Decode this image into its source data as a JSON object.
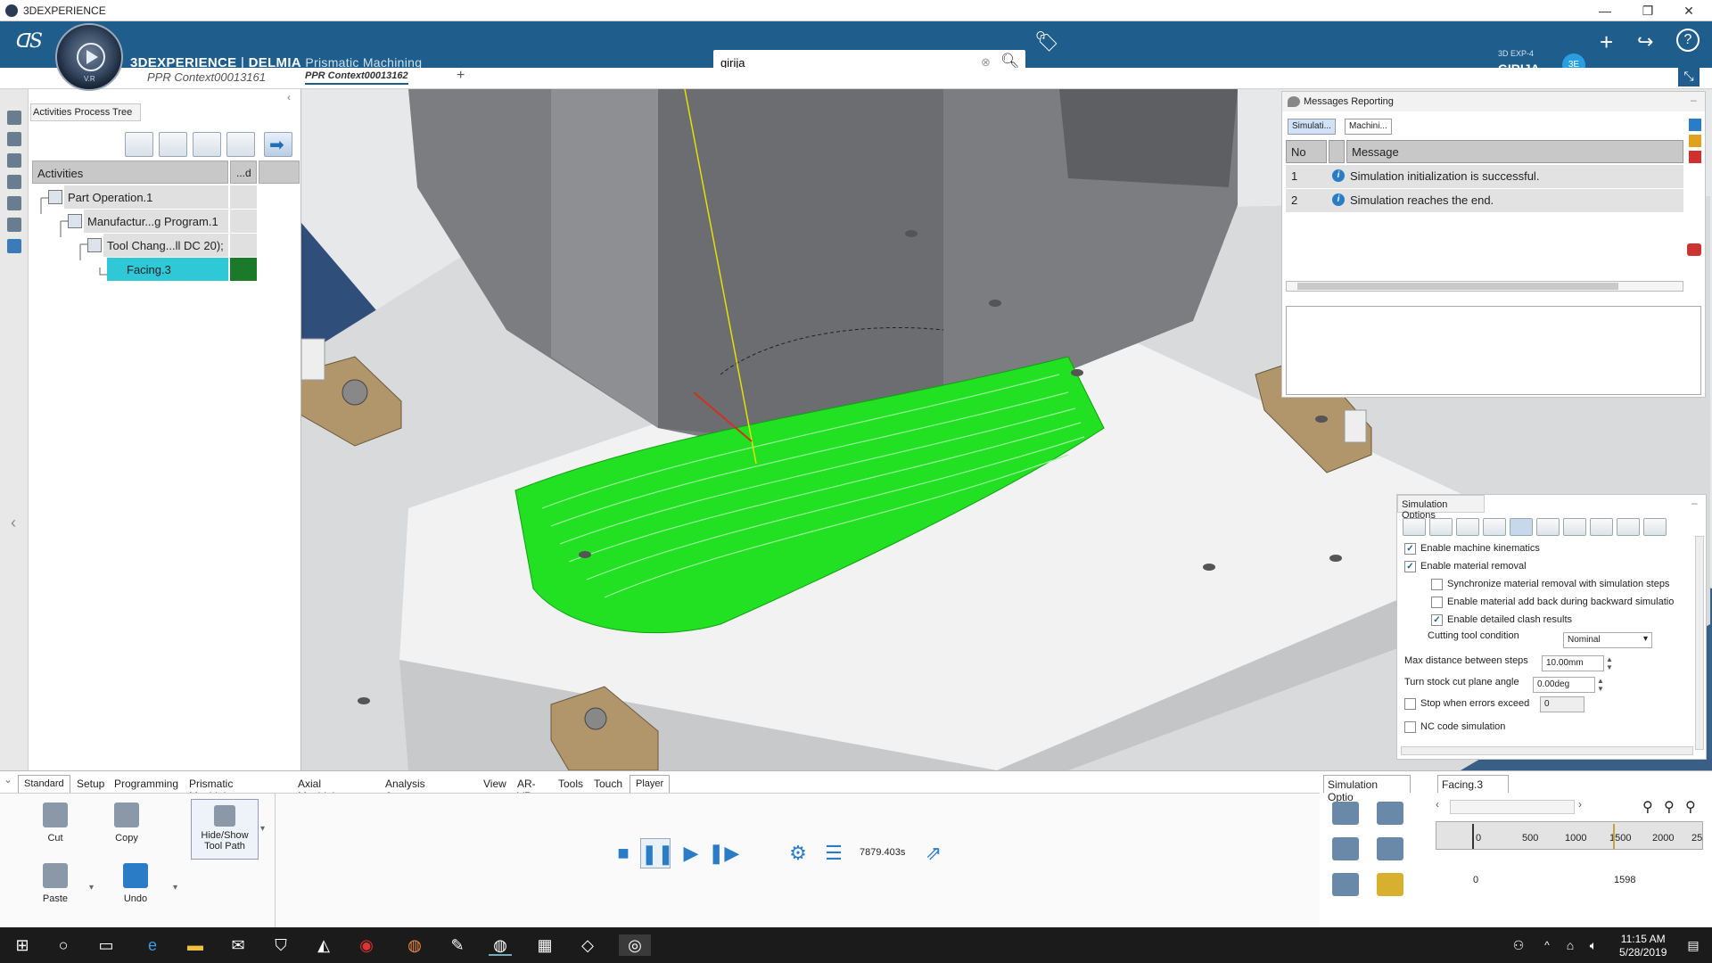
{
  "window": {
    "title": "3DEXPERIENCE",
    "min": "—",
    "restore": "❐",
    "close": "✕"
  },
  "app": {
    "brand": "3DEXPERIENCE",
    "sep": " | ",
    "module": "DELMIA",
    "sub_module": "Prismatic Machining",
    "compass_label": "V.R"
  },
  "search": {
    "value": "girija"
  },
  "user": {
    "platform": "3D EXP-4",
    "name": "GIRIJA ⌵",
    "badge": "3E"
  },
  "doc_tabs": [
    {
      "label": "PPR Context00013161"
    },
    {
      "label": "PPR Context00013162"
    }
  ],
  "add_tab": "+",
  "tree": {
    "panel_title": "Activities Process Tree",
    "col_activities": "Activities",
    "col_d": "...d",
    "rows": [
      {
        "label": "Part Operation.1"
      },
      {
        "label": "Manufactur...g Program.1"
      },
      {
        "label": "Tool Chang...ll DC 20);"
      },
      {
        "label": "Facing.3"
      }
    ]
  },
  "messages": {
    "title": "Messages Reporting",
    "tabs": [
      "Simulati...",
      "Machini..."
    ],
    "col_no": "No",
    "col_message": "Message",
    "rows": [
      {
        "no": "1",
        "message": "Simulation initialization is successful."
      },
      {
        "no": "2",
        "message": "Simulation reaches the end."
      }
    ]
  },
  "sim_options": {
    "title": "Simulation Options",
    "opts": [
      {
        "label": "Enable machine kinematics",
        "checked": true
      },
      {
        "label": "Enable material removal",
        "checked": true
      },
      {
        "label": "Synchronize material removal with simulation steps",
        "checked": false
      },
      {
        "label": "Enable material add back during backward simulatio",
        "checked": false
      },
      {
        "label": "Enable detailed clash results",
        "checked": true
      }
    ],
    "cutting_tool_label": "Cutting tool condition",
    "cutting_tool_value": "Nominal",
    "max_dist_label": "Max distance between steps",
    "max_dist_value": "10.00mm",
    "turn_stock_label": "Turn stock cut plane angle",
    "turn_stock_value": "0.00deg",
    "stop_errors_label": "Stop when errors exceed",
    "stop_errors_value": "0",
    "nc_code_label": "NC code simulation"
  },
  "workbench_tabs": [
    "Standard",
    "Setup",
    "Programming",
    "Prismatic Machining",
    "Axial Machining",
    "Analysis & Output",
    "View",
    "AR-VR",
    "Tools",
    "Touch",
    "Player"
  ],
  "actions": {
    "cut": "Cut",
    "copy": "Copy",
    "paste": "Paste",
    "undo": "Undo",
    "hide_show": "Hide/Show Tool Path"
  },
  "player": {
    "time": "7879.403s"
  },
  "right_bottom": {
    "tab1": "Simulation Optio",
    "tab2": "Facing.3",
    "ticks": [
      "0",
      "500",
      "1000",
      "1500",
      "2000",
      "25"
    ],
    "start": "0",
    "end": "1598"
  },
  "clock": {
    "time": "11:15 AM",
    "date": "5/28/2019"
  },
  "colors": {
    "appbar": "#1f5e8c",
    "toolpath": "#22e022",
    "selection": "#2ec8d6"
  }
}
